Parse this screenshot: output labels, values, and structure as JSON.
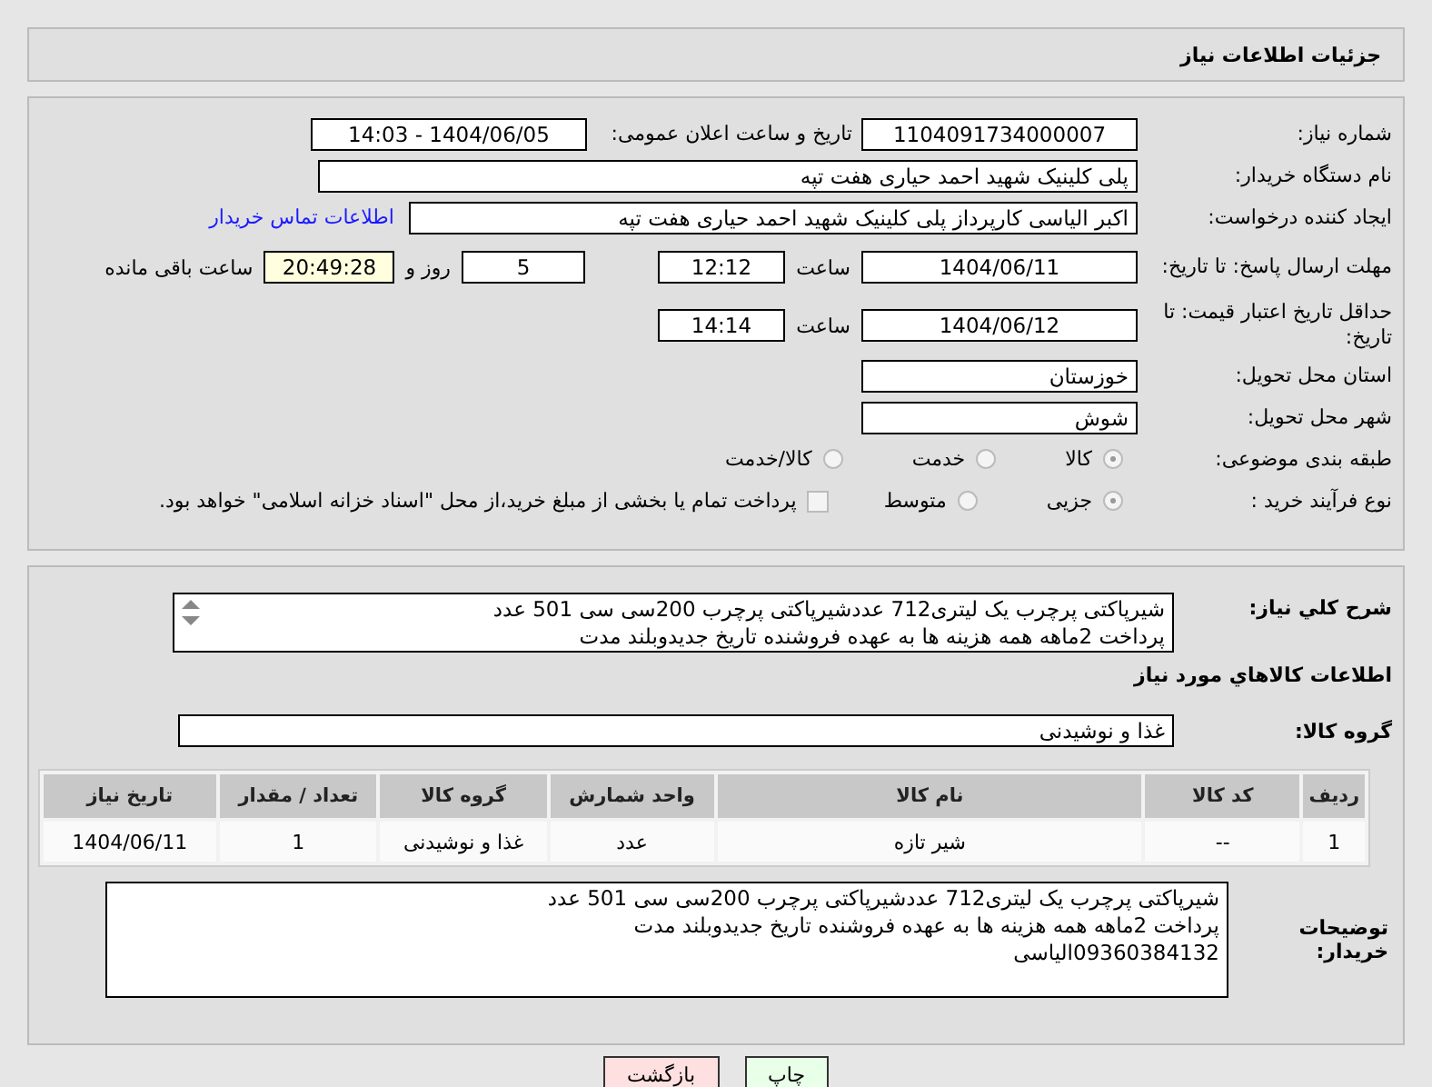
{
  "header": {
    "title": "جزئیات اطلاعات نیاز"
  },
  "form": {
    "need_number": {
      "label": "شماره نیاز:",
      "value": "1104091734000007"
    },
    "announce": {
      "label": "تاریخ و ساعت اعلان عمومی:",
      "value": "1404/06/05 - 14:03"
    },
    "buyer_org": {
      "label": "نام دستگاه خریدار:",
      "value": "پلی کلینیک شهید احمد حیاری هفت تپه"
    },
    "creator": {
      "label": "ایجاد کننده درخواست:",
      "value": "اکبر الیاسی کارپرداز پلی کلینیک شهید احمد حیاری هفت تپه",
      "link": "اطلاعات تماس خریدار"
    },
    "deadline": {
      "label": "مهلت ارسال پاسخ: تا تاریخ:",
      "date": "1404/06/11",
      "time_label": "ساعت",
      "time": "12:12",
      "days": "5",
      "days_label": "روز و",
      "remaining": "20:49:28",
      "remaining_label": "ساعت باقی مانده"
    },
    "validity": {
      "label": "حداقل تاریخ اعتبار قیمت: تا تاریخ:",
      "date": "1404/06/12",
      "time_label": "ساعت",
      "time": "14:14"
    },
    "province": {
      "label": "استان محل تحویل:",
      "value": "خوزستان"
    },
    "city": {
      "label": "شهر محل تحویل:",
      "value": "شوش"
    },
    "category": {
      "label": "طبقه بندی موضوعی:",
      "options": [
        {
          "label": "کالا",
          "selected": true
        },
        {
          "label": "خدمت",
          "selected": false
        },
        {
          "label": "کالا/خدمت",
          "selected": false
        }
      ]
    },
    "process": {
      "label": "نوع فرآیند خرید :",
      "options": [
        {
          "label": "جزیی",
          "selected": true
        },
        {
          "label": "متوسط",
          "selected": false
        }
      ],
      "treasury": {
        "label": "پرداخت تمام یا بخشی از مبلغ خرید،از محل \"اسناد خزانه اسلامی\" خواهد بود.",
        "checked": false
      }
    }
  },
  "details": {
    "description": {
      "label": "شرح کلي نیاز:",
      "lines": [
        "شیرپاکتی پرچرب یک لیتری712 عددشیرپاکتی پرچرب 200سی سی 501 عدد",
        "پرداخت 2ماهه همه هزینه ها به عهده فروشنده تاریخ جدیدوبلند مدت"
      ]
    },
    "goods_title": "اطلاعات کالاهاي مورد نیاز",
    "goods_group": {
      "label": "گروه کالا:",
      "value": "غذا و نوشیدنی"
    },
    "table": {
      "columns": [
        "ردیف",
        "کد کالا",
        "نام کالا",
        "واحد شمارش",
        "گروه کالا",
        "تعداد / مقدار",
        "تاریخ نیاز"
      ],
      "rows": [
        [
          "1",
          "--",
          "شیر تازه",
          "عدد",
          "غذا و نوشیدنی",
          "1",
          "1404/06/11"
        ]
      ]
    },
    "buyer_notes": {
      "label": "توضیحات خریدار:",
      "lines": [
        "شیرپاکتی پرچرب یک لیتری712 عددشیرپاکتی پرچرب 200سی سی 501 عدد",
        "پرداخت 2ماهه همه هزینه ها به عهده فروشنده تاریخ جدیدوبلند مدت",
        "09360384132الیاسی"
      ]
    }
  },
  "buttons": [
    {
      "kind": "print",
      "label": "چاپ"
    },
    {
      "kind": "back",
      "label": "بازگشت"
    }
  ]
}
